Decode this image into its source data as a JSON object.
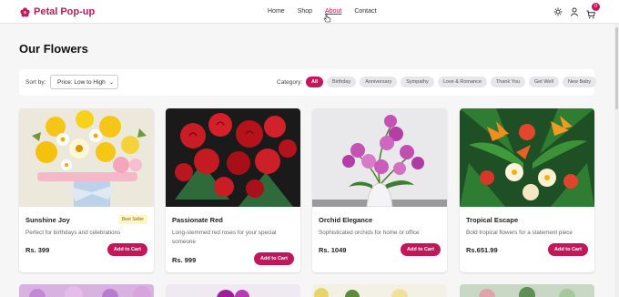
{
  "brand": {
    "name": "Petal Pop-up"
  },
  "nav": {
    "items": [
      "Home",
      "Shop",
      "About",
      "Contact"
    ],
    "active": "About"
  },
  "cart": {
    "count": "0"
  },
  "page": {
    "title": "Our Flowers"
  },
  "filters": {
    "sort_label": "Sort by:",
    "sort_value": "Price: Low to High",
    "category_label": "Category:",
    "categories": [
      "All",
      "Birthday",
      "Anniversary",
      "Sympathy",
      "Love & Romance",
      "Thank You",
      "Get Well",
      "New Baby"
    ],
    "active_category": "All"
  },
  "products": [
    {
      "name": "Sunshine Joy",
      "badge": "Best Seller",
      "description": "Perfect for birthdays and celebrations",
      "price": "Rs. 399",
      "button": "Add to Cart"
    },
    {
      "name": "Passionate Red",
      "badge": "",
      "description": "Long-stemmed red roses for your special someone",
      "price": "Rs. 999",
      "button": "Add to Cart"
    },
    {
      "name": "Orchid Elegance",
      "badge": "",
      "description": "Sophisticated orchids for home or office",
      "price": "Rs. 1049",
      "button": "Add to Cart"
    },
    {
      "name": "Tropical Escape",
      "badge": "",
      "description": "Bold tropical flowers for a statement piece",
      "price": "Rs.651.99",
      "button": "Add to Cart"
    }
  ],
  "colors": {
    "accent": "#c2185b",
    "background": "#f6f6f7"
  }
}
